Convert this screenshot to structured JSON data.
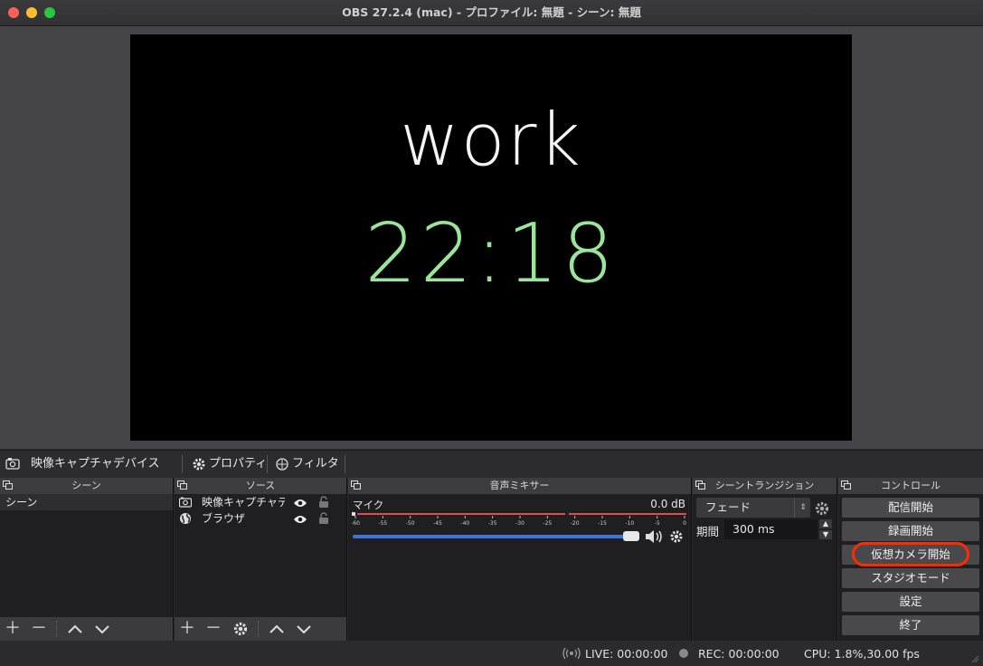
{
  "window": {
    "title": "OBS 27.2.4 (mac) - プロファイル: 無題 - シーン: 無題"
  },
  "preview": {
    "line1": "work",
    "line2": "22:18"
  },
  "source_toolbar": {
    "current_source": "映像キャプチャデバイス",
    "properties": "プロパティ",
    "filters": "フィルタ"
  },
  "scenes": {
    "header": "シーン",
    "items": [
      "シーン"
    ]
  },
  "sources": {
    "header": "ソース",
    "items": [
      {
        "label": "映像キャプチャデ",
        "icon": "camera-icon"
      },
      {
        "label": "ブラウザ",
        "icon": "globe-icon"
      }
    ]
  },
  "mixer": {
    "header": "音声ミキサー",
    "channel": "マイク",
    "level": "0.0 dB",
    "ticks": [
      "-60",
      "-55",
      "-50",
      "-45",
      "-40",
      "-35",
      "-30",
      "-25",
      "-20",
      "-15",
      "-10",
      "-5",
      "0"
    ],
    "volume_fraction": 1.0
  },
  "transitions": {
    "header": "シーントランジション",
    "selected": "フェード",
    "duration_label": "期間",
    "duration_value": "300 ms"
  },
  "controls": {
    "header": "コントロール",
    "buttons": [
      "配信開始",
      "録画開始",
      "仮想カメラ開始",
      "スタジオモード",
      "設定",
      "終了"
    ],
    "highlighted": "仮想カメラ開始",
    "highlight_color": "#ff2a00"
  },
  "status": {
    "live": "LIVE: 00:00:00",
    "rec": "REC: 00:00:00",
    "cpu": "CPU: 1.8%,30.00 fps"
  }
}
